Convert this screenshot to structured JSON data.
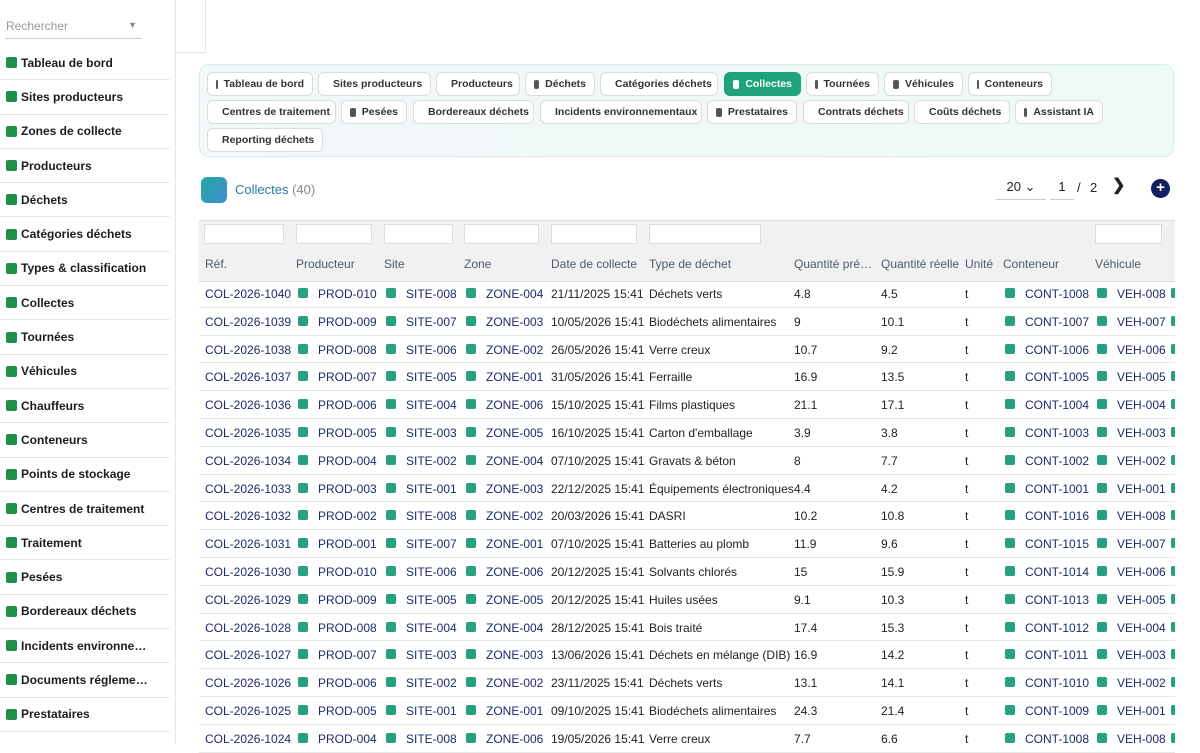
{
  "search": {
    "placeholder": "Rechercher"
  },
  "sidebar": {
    "items": [
      {
        "label": "Tableau de bord",
        "icon": "dashboard-icon"
      },
      {
        "label": "Sites producteurs",
        "icon": "factory-icon"
      },
      {
        "label": "Zones de collecte",
        "icon": "zones-icon"
      },
      {
        "label": "Producteurs",
        "icon": "building-icon"
      },
      {
        "label": "Déchets",
        "icon": "trash-icon"
      },
      {
        "label": "Catégories déchets",
        "icon": "layers-icon"
      },
      {
        "label": "Types & classification",
        "icon": "tags-icon"
      },
      {
        "label": "Collectes",
        "icon": "truck-load-icon"
      },
      {
        "label": "Tournées",
        "icon": "route-icon"
      },
      {
        "label": "Véhicules",
        "icon": "truck-icon"
      },
      {
        "label": "Chauffeurs",
        "icon": "id-card-icon"
      },
      {
        "label": "Conteneurs",
        "icon": "dumpster-icon"
      },
      {
        "label": "Points de stockage",
        "icon": "warehouse-icon"
      },
      {
        "label": "Centres de traitement",
        "icon": "recycle-icon"
      },
      {
        "label": "Traitement",
        "icon": "gears-icon"
      },
      {
        "label": "Pesées",
        "icon": "scale-icon"
      },
      {
        "label": "Bordereaux déchets",
        "icon": "file-signature-icon"
      },
      {
        "label": "Incidents environne…",
        "icon": "warning-icon"
      },
      {
        "label": "Documents réglemе…",
        "icon": "folder-icon"
      },
      {
        "label": "Prestataires",
        "icon": "handshake-icon"
      }
    ]
  },
  "nav": {
    "chips": [
      {
        "label": "Tableau de bord",
        "icon": "dashboard-icon",
        "active": false
      },
      {
        "label": "Sites producteurs",
        "icon": "factory-icon",
        "active": false
      },
      {
        "label": "Producteurs",
        "icon": "building-icon",
        "active": false
      },
      {
        "label": "Déchets",
        "icon": "trash-icon",
        "active": false
      },
      {
        "label": "Catégories déchets",
        "icon": "layers-icon",
        "active": false
      },
      {
        "label": "Collectes",
        "icon": "truck-load-icon",
        "active": true
      },
      {
        "label": "Tournées",
        "icon": "route-icon",
        "active": false
      },
      {
        "label": "Véhicules",
        "icon": "truck-icon",
        "active": false
      },
      {
        "label": "Conteneurs",
        "icon": "dumpster-icon",
        "active": false
      },
      {
        "label": "Centres de traitement",
        "icon": "recycle-icon",
        "active": false
      },
      {
        "label": "Pesées",
        "icon": "scale-icon",
        "active": false
      },
      {
        "label": "Bordereaux déchets",
        "icon": "file-signature-icon",
        "active": false
      },
      {
        "label": "Incidents environnementaux",
        "icon": "warning-icon",
        "active": false
      },
      {
        "label": "Prestataires",
        "icon": "handshake-icon",
        "active": false
      },
      {
        "label": "Contrats déchets",
        "icon": "contract-icon",
        "active": false
      },
      {
        "label": "Coûts déchets",
        "icon": "coins-icon",
        "active": false
      },
      {
        "label": "Assistant IA",
        "icon": "robot-icon",
        "active": false
      },
      {
        "label": "Reporting déchets",
        "icon": "chart-pie-icon",
        "active": false
      }
    ]
  },
  "header": {
    "title": "Collectes",
    "count": "(40)"
  },
  "pager": {
    "page_size": "20 ⌄",
    "current": "1",
    "sep": "/",
    "total": "2",
    "next": "❯",
    "add": "+"
  },
  "table": {
    "columns": [
      "Réf.",
      "Producteur",
      "Site",
      "Zone",
      "Date de collecte",
      "Type de déchet",
      "Quantité pré…",
      "Quantité réelle",
      "Unité",
      "Conteneur",
      "Véhicule"
    ],
    "rows": [
      [
        "COL-2026-1040",
        "PROD-010",
        "SITE-008",
        "ZONE-004",
        "21/11/2025 15:41",
        "Déchets verts",
        "4.8",
        "4.5",
        "t",
        "CONT-1008",
        "VEH-008"
      ],
      [
        "COL-2026-1039",
        "PROD-009",
        "SITE-007",
        "ZONE-003",
        "10/05/2026 15:41",
        "Biodéchets alimentaires",
        "9",
        "10.1",
        "t",
        "CONT-1007",
        "VEH-007"
      ],
      [
        "COL-2026-1038",
        "PROD-008",
        "SITE-006",
        "ZONE-002",
        "26/05/2026 15:41",
        "Verre creux",
        "10.7",
        "9.2",
        "t",
        "CONT-1006",
        "VEH-006"
      ],
      [
        "COL-2026-1037",
        "PROD-007",
        "SITE-005",
        "ZONE-001",
        "31/05/2026 15:41",
        "Ferraille",
        "16.9",
        "13.5",
        "t",
        "CONT-1005",
        "VEH-005"
      ],
      [
        "COL-2026-1036",
        "PROD-006",
        "SITE-004",
        "ZONE-006",
        "15/10/2025 15:41",
        "Films plastiques",
        "21.1",
        "17.1",
        "t",
        "CONT-1004",
        "VEH-004"
      ],
      [
        "COL-2026-1035",
        "PROD-005",
        "SITE-003",
        "ZONE-005",
        "16/10/2025 15:41",
        "Carton d'emballage",
        "3.9",
        "3.8",
        "t",
        "CONT-1003",
        "VEH-003"
      ],
      [
        "COL-2026-1034",
        "PROD-004",
        "SITE-002",
        "ZONE-004",
        "07/10/2025 15:41",
        "Gravats & béton",
        "8",
        "7.7",
        "t",
        "CONT-1002",
        "VEH-002"
      ],
      [
        "COL-2026-1033",
        "PROD-003",
        "SITE-001",
        "ZONE-003",
        "22/12/2025 15:41",
        "Équipements électroniques",
        "4.4",
        "4.2",
        "t",
        "CONT-1001",
        "VEH-001"
      ],
      [
        "COL-2026-1032",
        "PROD-002",
        "SITE-008",
        "ZONE-002",
        "20/03/2026 15:41",
        "DASRI",
        "10.2",
        "10.8",
        "t",
        "CONT-1016",
        "VEH-008"
      ],
      [
        "COL-2026-1031",
        "PROD-001",
        "SITE-007",
        "ZONE-001",
        "07/10/2025 15:41",
        "Batteries au plomb",
        "11.9",
        "9.6",
        "t",
        "CONT-1015",
        "VEH-007"
      ],
      [
        "COL-2026-1030",
        "PROD-010",
        "SITE-006",
        "ZONE-006",
        "20/12/2025 15:41",
        "Solvants chlorés",
        "15",
        "15.9",
        "t",
        "CONT-1014",
        "VEH-006"
      ],
      [
        "COL-2026-1029",
        "PROD-009",
        "SITE-005",
        "ZONE-005",
        "20/12/2025 15:41",
        "Huiles usées",
        "9.1",
        "10.3",
        "t",
        "CONT-1013",
        "VEH-005"
      ],
      [
        "COL-2026-1028",
        "PROD-008",
        "SITE-004",
        "ZONE-004",
        "28/12/2025 15:41",
        "Bois traité",
        "17.4",
        "15.3",
        "t",
        "CONT-1012",
        "VEH-004"
      ],
      [
        "COL-2026-1027",
        "PROD-007",
        "SITE-003",
        "ZONE-003",
        "13/06/2026 15:41",
        "Déchets en mélange (DIB)",
        "16.9",
        "14.2",
        "t",
        "CONT-1011",
        "VEH-003"
      ],
      [
        "COL-2026-1026",
        "PROD-006",
        "SITE-002",
        "ZONE-002",
        "23/11/2025 15:41",
        "Déchets verts",
        "13.1",
        "14.1",
        "t",
        "CONT-1010",
        "VEH-002"
      ],
      [
        "COL-2026-1025",
        "PROD-005",
        "SITE-001",
        "ZONE-001",
        "09/10/2025 15:41",
        "Biodéchets alimentaires",
        "24.3",
        "21.4",
        "t",
        "CONT-1009",
        "VEH-001"
      ],
      [
        "COL-2026-1024",
        "PROD-004",
        "SITE-008",
        "ZONE-006",
        "19/05/2026 15:41",
        "Verre creux",
        "7.7",
        "6.6",
        "t",
        "CONT-1008",
        "VEH-008"
      ]
    ]
  }
}
